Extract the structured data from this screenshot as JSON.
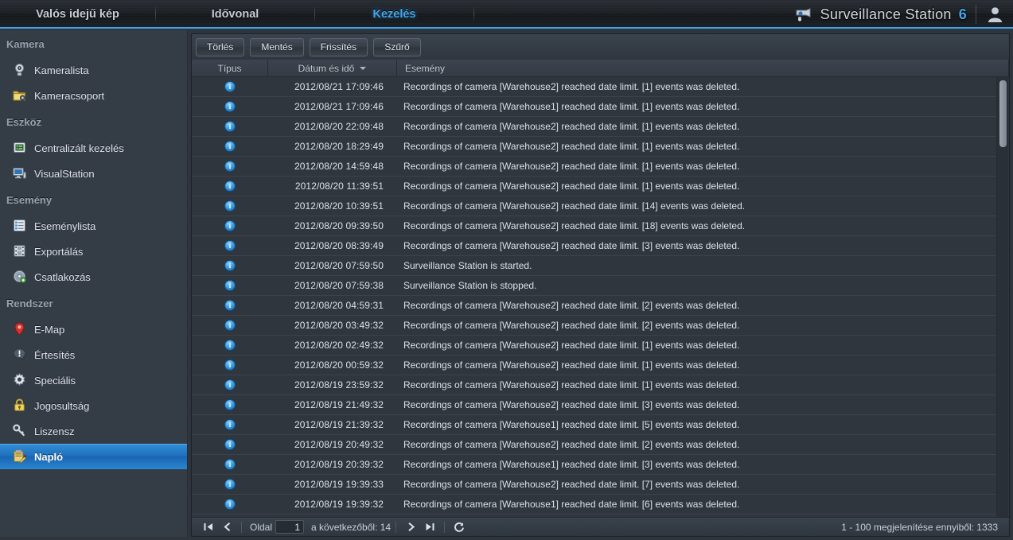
{
  "header": {
    "tabs": [
      {
        "label": "Valós idejű kép",
        "active": false
      },
      {
        "label": "Idővonal",
        "active": false
      },
      {
        "label": "Kezelés",
        "active": true
      }
    ],
    "brand": "Surveillance Station",
    "brand_version": "6",
    "brand_icon": "camera-icon",
    "user_icon": "user-avatar-icon",
    "accent_color": "#43a7ea"
  },
  "sidebar": {
    "sections": [
      {
        "title": "Kamera",
        "items": [
          {
            "label": "Kameralista",
            "icon": "webcam-icon",
            "selected": false
          },
          {
            "label": "Kameracsoport",
            "icon": "folder-camera-icon",
            "selected": false
          }
        ]
      },
      {
        "title": "Eszköz",
        "items": [
          {
            "label": "Centralizált kezelés",
            "icon": "server-list-icon",
            "selected": false
          },
          {
            "label": "VisualStation",
            "icon": "monitor-icon",
            "selected": false
          }
        ]
      },
      {
        "title": "Esemény",
        "items": [
          {
            "label": "Eseménylista",
            "icon": "list-icon",
            "selected": false
          },
          {
            "label": "Exportálás",
            "icon": "film-icon",
            "selected": false
          },
          {
            "label": "Csatlakozás",
            "icon": "disc-icon",
            "selected": false
          }
        ]
      },
      {
        "title": "Rendszer",
        "items": [
          {
            "label": "E-Map",
            "icon": "map-pin-icon",
            "selected": false
          },
          {
            "label": "Értesítés",
            "icon": "notification-icon",
            "selected": false
          },
          {
            "label": "Speciális",
            "icon": "gear-icon",
            "selected": false
          },
          {
            "label": "Jogosultság",
            "icon": "lock-icon",
            "selected": false
          },
          {
            "label": "Liszensz",
            "icon": "key-icon",
            "selected": false
          },
          {
            "label": "Napló",
            "icon": "clipboard-icon",
            "selected": true
          }
        ]
      }
    ],
    "selected_color": "#2f8fd8"
  },
  "toolbar": {
    "buttons": [
      {
        "label": "Törlés",
        "name": "delete-button"
      },
      {
        "label": "Mentés",
        "name": "save-button"
      },
      {
        "label": "Frissítés",
        "name": "refresh-button"
      },
      {
        "label": "Szűrő",
        "name": "filter-button"
      }
    ]
  },
  "table": {
    "columns": [
      {
        "label": "Típus",
        "key": "type",
        "align": "center",
        "sorted": false
      },
      {
        "label": "Dátum és idő",
        "key": "date",
        "align": "center",
        "sorted": true,
        "sort_dir": "desc"
      },
      {
        "label": "Esemény",
        "key": "event",
        "align": "left",
        "sorted": false
      }
    ],
    "rows": [
      {
        "type": "info-icon",
        "date": "2012/08/21 17:09:46",
        "event": "Recordings of camera [Warehouse2] reached date limit. [1] events was deleted."
      },
      {
        "type": "info-icon",
        "date": "2012/08/21 17:09:46",
        "event": "Recordings of camera [Warehouse1] reached date limit. [1] events was deleted."
      },
      {
        "type": "info-icon",
        "date": "2012/08/20 22:09:48",
        "event": "Recordings of camera [Warehouse2] reached date limit. [1] events was deleted."
      },
      {
        "type": "info-icon",
        "date": "2012/08/20 18:29:49",
        "event": "Recordings of camera [Warehouse2] reached date limit. [1] events was deleted."
      },
      {
        "type": "info-icon",
        "date": "2012/08/20 14:59:48",
        "event": "Recordings of camera [Warehouse2] reached date limit. [1] events was deleted."
      },
      {
        "type": "info-icon",
        "date": "2012/08/20 11:39:51",
        "event": "Recordings of camera [Warehouse2] reached date limit. [1] events was deleted."
      },
      {
        "type": "info-icon",
        "date": "2012/08/20 10:39:51",
        "event": "Recordings of camera [Warehouse2] reached date limit. [14] events was deleted."
      },
      {
        "type": "info-icon",
        "date": "2012/08/20 09:39:50",
        "event": "Recordings of camera [Warehouse2] reached date limit. [18] events was deleted."
      },
      {
        "type": "info-icon",
        "date": "2012/08/20 08:39:49",
        "event": "Recordings of camera [Warehouse2] reached date limit. [3] events was deleted."
      },
      {
        "type": "info-icon",
        "date": "2012/08/20 07:59:50",
        "event": "Surveillance Station is started."
      },
      {
        "type": "info-icon",
        "date": "2012/08/20 07:59:38",
        "event": "Surveillance Station is stopped."
      },
      {
        "type": "info-icon",
        "date": "2012/08/20 04:59:31",
        "event": "Recordings of camera [Warehouse2] reached date limit. [2] events was deleted."
      },
      {
        "type": "info-icon",
        "date": "2012/08/20 03:49:32",
        "event": "Recordings of camera [Warehouse2] reached date limit. [2] events was deleted."
      },
      {
        "type": "info-icon",
        "date": "2012/08/20 02:49:32",
        "event": "Recordings of camera [Warehouse2] reached date limit. [1] events was deleted."
      },
      {
        "type": "info-icon",
        "date": "2012/08/20 00:59:32",
        "event": "Recordings of camera [Warehouse2] reached date limit. [1] events was deleted."
      },
      {
        "type": "info-icon",
        "date": "2012/08/19 23:59:32",
        "event": "Recordings of camera [Warehouse2] reached date limit. [1] events was deleted."
      },
      {
        "type": "info-icon",
        "date": "2012/08/19 21:49:32",
        "event": "Recordings of camera [Warehouse2] reached date limit. [3] events was deleted."
      },
      {
        "type": "info-icon",
        "date": "2012/08/19 21:39:32",
        "event": "Recordings of camera [Warehouse1] reached date limit. [5] events was deleted."
      },
      {
        "type": "info-icon",
        "date": "2012/08/19 20:49:32",
        "event": "Recordings of camera [Warehouse2] reached date limit. [2] events was deleted."
      },
      {
        "type": "info-icon",
        "date": "2012/08/19 20:39:32",
        "event": "Recordings of camera [Warehouse1] reached date limit. [3] events was deleted."
      },
      {
        "type": "info-icon",
        "date": "2012/08/19 19:39:33",
        "event": "Recordings of camera [Warehouse2] reached date limit. [7] events was deleted."
      },
      {
        "type": "info-icon",
        "date": "2012/08/19 19:39:32",
        "event": "Recordings of camera [Warehouse1] reached date limit. [6] events was deleted."
      }
    ]
  },
  "pagination": {
    "first_icon": "first-page-icon",
    "prev_icon": "prev-page-icon",
    "next_icon": "next-page-icon",
    "last_icon": "last-page-icon",
    "reload_icon": "reload-icon",
    "page_label": "Oldal",
    "page_value": "1",
    "of_total": "a következőből: 14",
    "count_info": "1 - 100 megjelenítése ennyiből: 1333"
  }
}
